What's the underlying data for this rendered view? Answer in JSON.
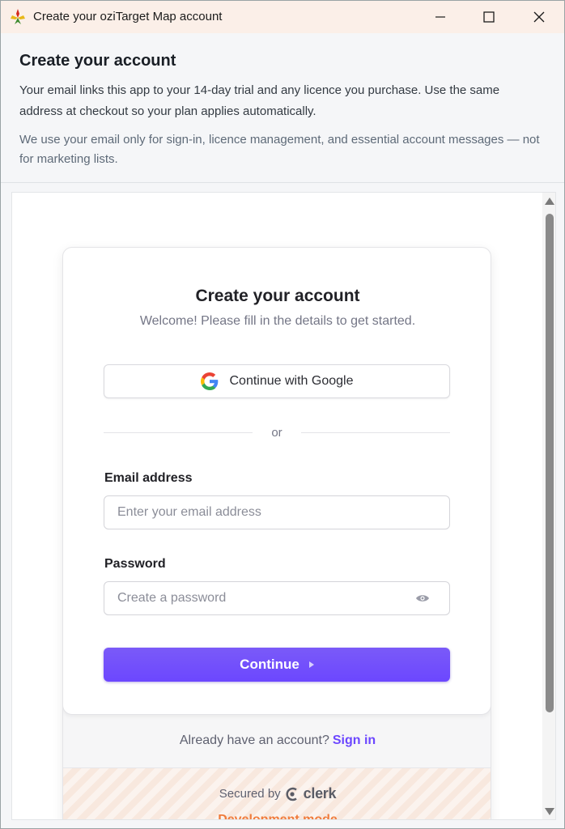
{
  "window": {
    "title": "Create your oziTarget Map account",
    "icons": {
      "app": "app-logo-icon",
      "minimize": "minimize-icon",
      "maximize": "maximize-icon",
      "close": "close-icon"
    }
  },
  "header": {
    "title": "Create your account",
    "paragraph1": "Your email links this app to your 14-day trial and any licence you purchase. Use the same address at checkout so your plan applies automatically.",
    "paragraph2": "We use your email only for sign-in, licence management, and essential account messages — not for marketing lists."
  },
  "card": {
    "title": "Create your account",
    "subtitle": "Welcome! Please fill in the details to get started.",
    "google_button_label": "Continue with Google",
    "divider_text": "or",
    "email": {
      "label": "Email address",
      "placeholder": "Enter your email address",
      "value": ""
    },
    "password": {
      "label": "Password",
      "placeholder": "Create a password",
      "value": ""
    },
    "continue_button_label": "Continue"
  },
  "footer": {
    "signin_prompt": "Already have an account?",
    "signin_link": "Sign in",
    "secured_by": "Secured by",
    "brand": "clerk",
    "dev_mode": "Development mode"
  },
  "colors": {
    "accent": "#6c47ff",
    "title_bar": "#fbefe8",
    "dev_mode": "#f07c3c"
  }
}
